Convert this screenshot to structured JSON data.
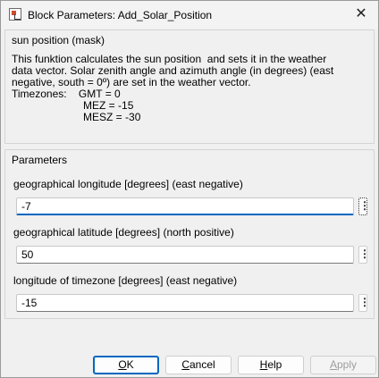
{
  "window": {
    "title": "Block Parameters: Add_Solar_Position",
    "icon": "simulink-block-icon",
    "close_glyph": "✕"
  },
  "mask": {
    "label": "sun position (mask)",
    "description": "This funktion calculates the sun position  and sets it in the weather\ndata vector. Solar zenith angle and azimuth angle (in degrees) (east\nnegative, south = 0º) are set in the weather vector.\nTimezones:    GMT = 0\n                        MEZ = -15\n                        MESZ = -30"
  },
  "parameters": {
    "label": "Parameters",
    "fields": [
      {
        "label": "geographical longitude [degrees] (east negative)",
        "value": "-7"
      },
      {
        "label": "geographical latitude [degrees] (north positive)",
        "value": "50"
      },
      {
        "label": "longitude of timezone [degrees] (east negative)",
        "value": "-15"
      }
    ],
    "menu_glyph": "⋮"
  },
  "buttons": {
    "ok": {
      "pre": "",
      "key": "O",
      "post": "K"
    },
    "cancel": {
      "pre": "",
      "key": "C",
      "post": "ancel"
    },
    "help": {
      "pre": "",
      "key": "H",
      "post": "elp"
    },
    "apply": {
      "pre": "",
      "key": "A",
      "post": "pply"
    }
  },
  "colors": {
    "accent": "#0067c0",
    "disabled_text": "#9d9d9d"
  }
}
